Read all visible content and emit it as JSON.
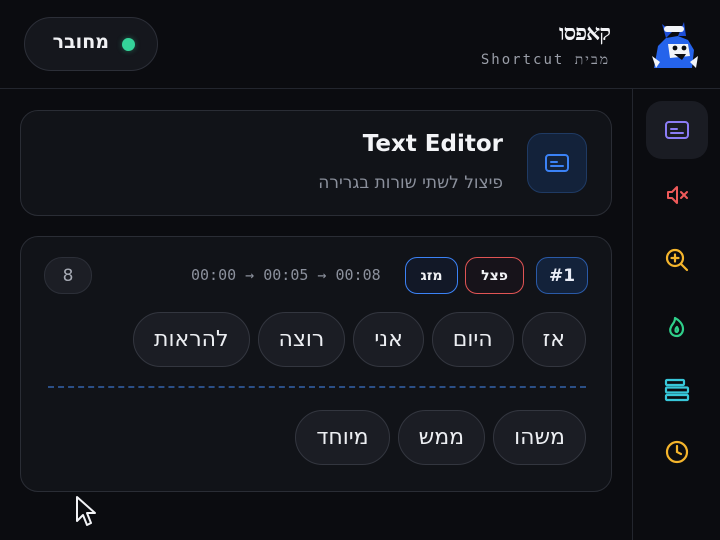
{
  "header": {
    "brand_name": "קאפסו",
    "brand_subtitle": "מבית Shortcut",
    "status": {
      "label": "מחובר",
      "color": "#34d399"
    }
  },
  "rail": {
    "items": [
      {
        "name": "subtitles-icon",
        "color": "#8b7cf6",
        "active": true
      },
      {
        "name": "mute-icon",
        "color": "#ef5a5a",
        "active": false
      },
      {
        "name": "zoom-in-icon",
        "color": "#f5b52c",
        "active": false
      },
      {
        "name": "flame-icon",
        "color": "#2fcf8a",
        "active": false
      },
      {
        "name": "align-bars-icon",
        "color": "#38c7d9",
        "active": false
      },
      {
        "name": "clock-icon",
        "color": "#f5b52c",
        "active": false
      }
    ]
  },
  "tool": {
    "title": "Text Editor",
    "subtitle": "פיצול לשתי שורות בגרירה",
    "icon": "subtitles-icon",
    "accent": "#3b82f6"
  },
  "segment": {
    "index_label": "#1",
    "split_label": "פצל",
    "merge_label": "מזג",
    "timecode": "00:00 → 00:05 → 00:08",
    "word_count": "8",
    "line1": [
      "אז",
      "היום",
      "אני",
      "רוצה",
      "להראות"
    ],
    "line2": [
      "משהו",
      "ממש",
      "מיוחד"
    ]
  }
}
